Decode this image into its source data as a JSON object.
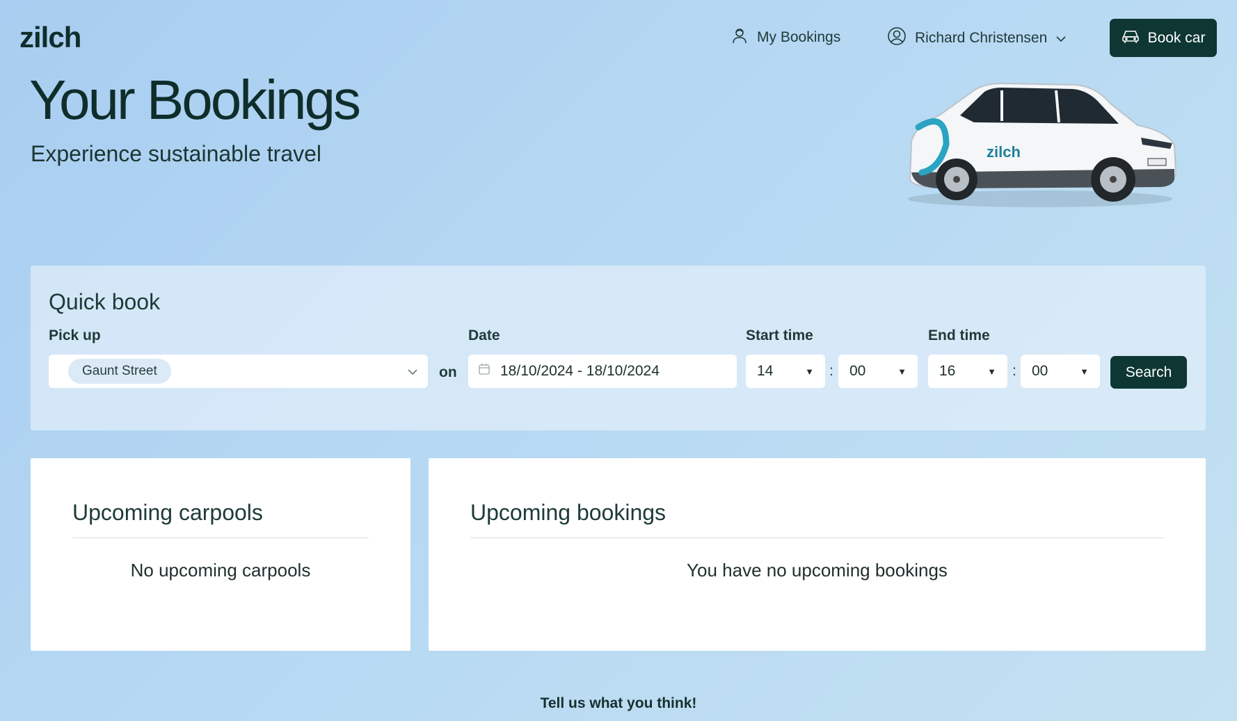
{
  "header": {
    "logo": "zilch",
    "my_bookings": "My Bookings",
    "user_name": "Richard Christensen",
    "book_car": "Book car"
  },
  "hero": {
    "title": "Your Bookings",
    "subtitle": "Experience sustainable travel",
    "car_logo_text": "zilch"
  },
  "quick_book": {
    "title": "Quick book",
    "pickup_label": "Pick up",
    "pickup_value": "Gaunt Street",
    "on": "on",
    "date_label": "Date",
    "date_value": "18/10/2024 - 18/10/2024",
    "start_label": "Start time",
    "start_hour": "14",
    "start_minute": "00",
    "end_label": "End time",
    "end_hour": "16",
    "end_minute": "00",
    "colon": ":",
    "search": "Search"
  },
  "carpools": {
    "title": "Upcoming carpools",
    "empty": "No upcoming carpools"
  },
  "bookings": {
    "title": "Upcoming bookings",
    "empty": "You have no upcoming bookings"
  },
  "footer": {
    "feedback": "Tell us what you think!"
  },
  "colors": {
    "brand_dark": "#0e3733",
    "background": "#b6d8f3"
  }
}
